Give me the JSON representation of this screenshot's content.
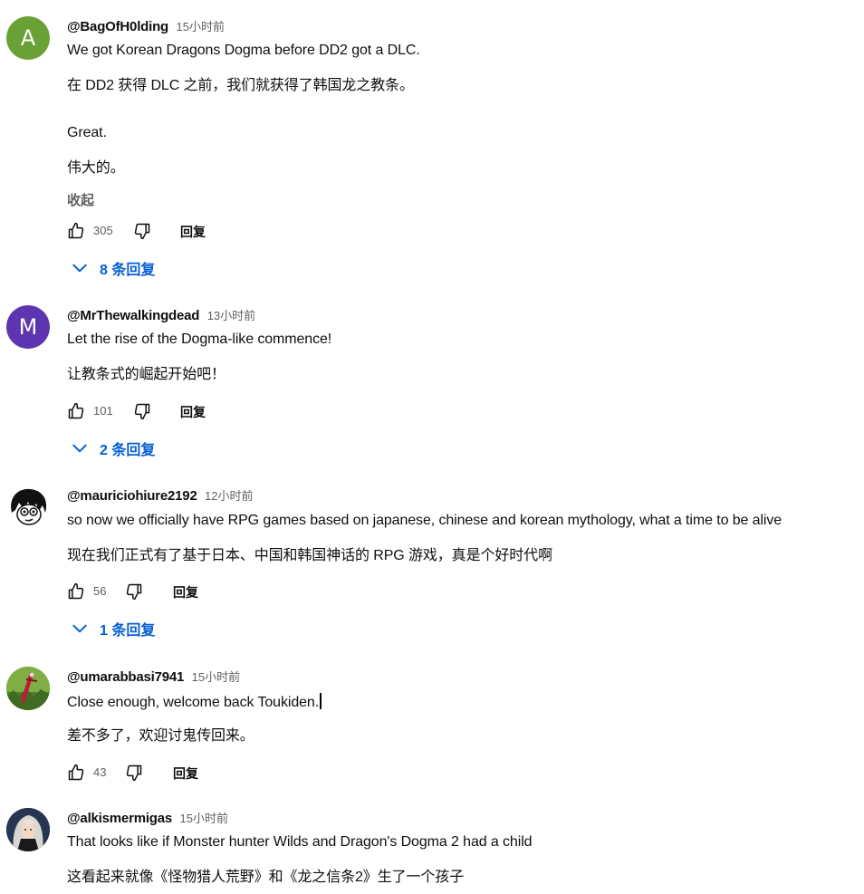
{
  "colors": {
    "link_blue": "#065fd4",
    "meta_gray": "#606060",
    "avatar_a": "#6aa136",
    "avatar_m": "#5e35b1"
  },
  "comments": [
    {
      "avatar_letter": "A",
      "handle": "@BagOfH0lding",
      "time": "15小时前",
      "lines": [
        "We got Korean Dragons Dogma before DD2 got a DLC.",
        "在 DD2 获得 DLC 之前，我们就获得了韩国龙之教条。",
        "Great.",
        "伟大的。"
      ],
      "collapse_label": "收起",
      "likes": "305",
      "reply_label": "回复",
      "replies_label": "8 条回复"
    },
    {
      "avatar_letter": "M",
      "handle": "@MrThewalkingdead",
      "time": "13小时前",
      "lines": [
        "Let the rise of the Dogma-like commence!",
        "让教条式的崛起开始吧！"
      ],
      "likes": "101",
      "reply_label": "回复",
      "replies_label": "2 条回复"
    },
    {
      "avatar_icon": "cartoon-face-avatar",
      "handle": "@mauriciohiure2192",
      "time": "12小时前",
      "lines": [
        "so now we officially have RPG games based on japanese, chinese and korean mythology, what a time to be alive",
        "现在我们正式有了基于日本、中国和韩国神话的 RPG 游戏，真是个好时代啊"
      ],
      "likes": "56",
      "reply_label": "回复",
      "replies_label": "1 条回复"
    },
    {
      "avatar_icon": "sword-grass-avatar",
      "handle": "@umarabbasi7941",
      "time": "15小时前",
      "lines": [
        "Close enough, welcome back Toukiden.",
        "差不多了，欢迎讨鬼传回来。"
      ],
      "likes": "43",
      "reply_label": "回复"
    },
    {
      "avatar_icon": "anime-character-avatar",
      "handle": "@alkismermigas",
      "time": "15小时前",
      "lines": [
        "That looks like if Monster hunter Wilds and Dragon's Dogma 2 had a child",
        "这看起来就像《怪物猎人荒野》和《龙之信条2》生了一个孩子"
      ]
    }
  ]
}
